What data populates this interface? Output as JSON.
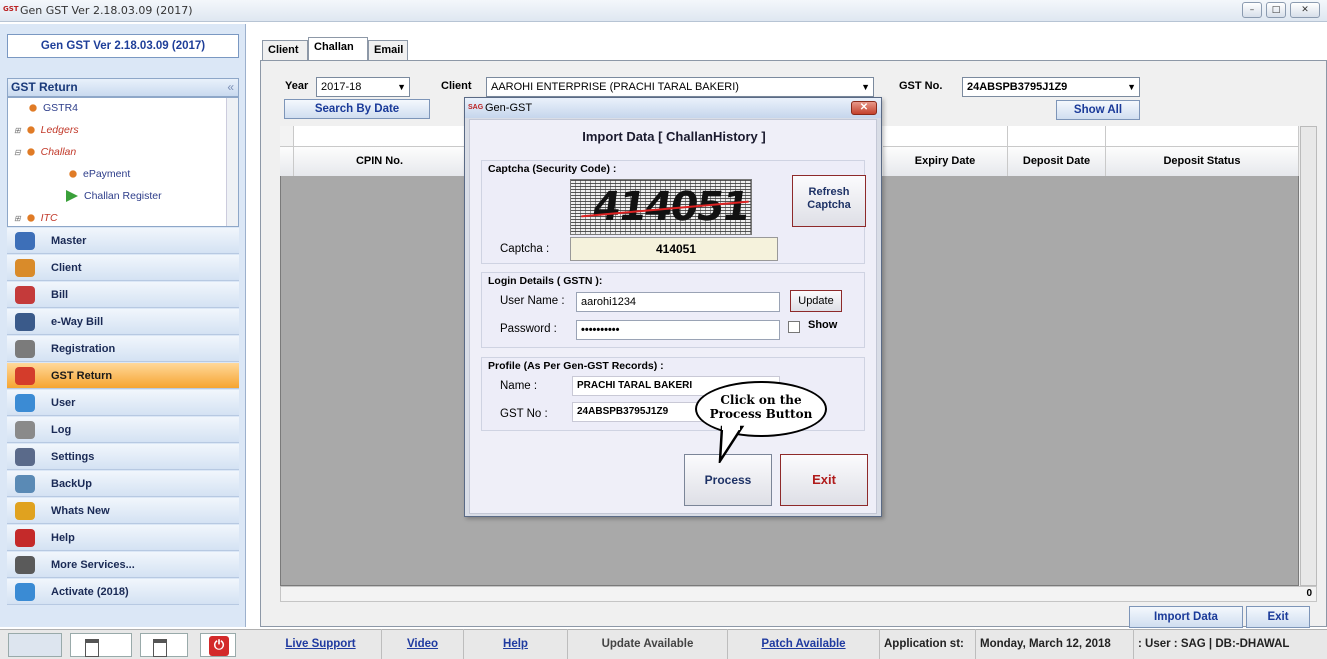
{
  "window": {
    "title": "Gen GST  Ver 2.18.03.09 (2017)",
    "logo_text": "GST",
    "controls": [
      "minimize-icon",
      "restore-icon",
      "close-icon"
    ]
  },
  "sidebar": {
    "app_version": "Gen GST  Ver 2.18.03.09 (2017)",
    "section_title": "GST Return",
    "tree": [
      {
        "label": "GSTR4",
        "style": "normal"
      },
      {
        "label": "Ledgers",
        "style": "italic"
      },
      {
        "label": "Challan",
        "style": "italic"
      },
      {
        "label": "ePayment",
        "style": "child"
      },
      {
        "label": "Challan Register",
        "style": "child"
      },
      {
        "label": "ITC",
        "style": "italic"
      }
    ],
    "nav": [
      {
        "label": "Master",
        "icon": "master-icon"
      },
      {
        "label": "Client",
        "icon": "client-icon"
      },
      {
        "label": "Bill",
        "icon": "bill-icon"
      },
      {
        "label": "e-Way Bill",
        "icon": "eway-bill-icon"
      },
      {
        "label": "Registration",
        "icon": "registration-icon"
      },
      {
        "label": "GST Return",
        "icon": "gst-icon",
        "active": true
      },
      {
        "label": "User",
        "icon": "user-icon"
      },
      {
        "label": "Log",
        "icon": "log-icon"
      },
      {
        "label": "Settings",
        "icon": "settings-icon"
      },
      {
        "label": "BackUp",
        "icon": "backup-icon"
      },
      {
        "label": "Whats New",
        "icon": "new-icon"
      },
      {
        "label": "Help",
        "icon": "help-icon"
      },
      {
        "label": "More Services...",
        "icon": "services-icon"
      },
      {
        "label": "Activate (2018)",
        "icon": "key-icon"
      }
    ]
  },
  "tabs": [
    {
      "label": "Client"
    },
    {
      "label": "Challan",
      "selected": true
    },
    {
      "label": "Email"
    }
  ],
  "filters": {
    "year_label": "Year",
    "year_value": "2017-18",
    "client_label": "Client",
    "client_value": "AAROHI ENTERPRISE (PRACHI TARAL BAKERI)",
    "gst_label": "GST No.",
    "gst_value": "24ABSPB3795J1Z9",
    "search_by_date": "Search By Date",
    "show_all": "Show All"
  },
  "grid": {
    "columns": [
      "CPIN No.",
      "Expiry Date",
      "Deposit Date",
      "Deposit Status"
    ],
    "row_count": "0"
  },
  "actions": {
    "import_data": "Import Data",
    "exit": "Exit"
  },
  "dialog": {
    "title": "Gen-GST",
    "title_logo": "SAG",
    "heading": "Import Data [ ChallanHistory ]",
    "captcha_group": "Captcha (Security Code) :",
    "captcha_image_text": "414051",
    "refresh_captcha": "Refresh Captcha",
    "captcha_label": "Captcha :",
    "captcha_value": "414051",
    "login_group": "Login Details ( GSTN ):",
    "username_label": "User Name :",
    "username_value": "aarohi1234",
    "update_button": "Update",
    "password_label": "Password :",
    "password_value": "••••••••••",
    "show_label": "Show",
    "profile_group": "Profile (As Per Gen-GST Records) :",
    "name_label": "Name :",
    "name_value": "PRACHI TARAL BAKERI",
    "gstno_label": "GST No :",
    "gstno_value": "24ABSPB3795J1Z9",
    "process_button": "Process",
    "exit_button": "Exit"
  },
  "callout": {
    "line1": "Click on the",
    "line2": "Process Button"
  },
  "statusbar": {
    "live_support": "Live Support",
    "video": "Video",
    "help": "Help",
    "update_available": "Update Available",
    "patch_available": "Patch Available",
    "app_status": "Application st:",
    "date": "Monday, March 12, 2018",
    "user_db": ": User : SAG | DB:-DHAWAL"
  }
}
